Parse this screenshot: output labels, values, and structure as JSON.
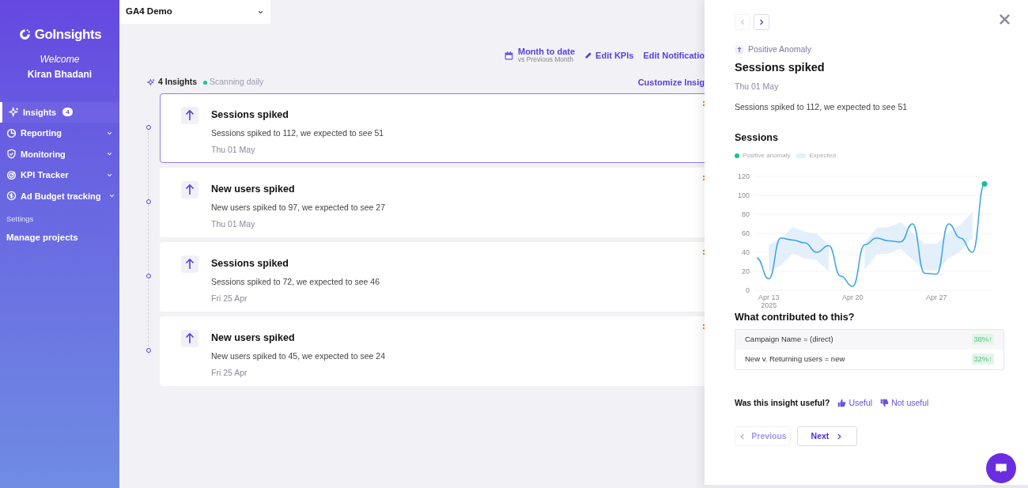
{
  "sidebar": {
    "logo": "GoInsights",
    "welcome": "Welcome",
    "user": "Kiran Bhadani",
    "items": [
      {
        "label": "Insights",
        "badge": "4",
        "selected": true,
        "expandable": false
      },
      {
        "label": "Reporting",
        "selected": false,
        "expandable": true
      },
      {
        "label": "Monitoring",
        "selected": false,
        "expandable": true
      },
      {
        "label": "KPI Tracker",
        "selected": false,
        "expandable": true
      },
      {
        "label": "Ad Budget tracking",
        "selected": false,
        "expandable": true
      }
    ],
    "section": "Settings",
    "links": [
      "Manage projects"
    ]
  },
  "project_select": {
    "value": "GA4 Demo"
  },
  "toolbar": {
    "period": "Month to date",
    "comparison": "vs Previous Month",
    "actions": [
      "Edit KPIs",
      "Edit Notificatio"
    ],
    "customize": "Customize Insig"
  },
  "summary": {
    "count": "4 Insights",
    "status": "Scanning daily"
  },
  "insights": [
    {
      "title": "Sessions spiked",
      "detail": "Sessions spiked to 112, we expected to see 51",
      "date": "Thu 01 May",
      "selected": true
    },
    {
      "title": "New users spiked",
      "detail": "New users spiked to 97, we expected to see 27",
      "date": "Thu 01 May",
      "selected": false
    },
    {
      "title": "Sessions spiked",
      "detail": "Sessions spiked to 72, we expected to see 46",
      "date": "Fri 25 Apr",
      "selected": false
    },
    {
      "title": "New users spiked",
      "detail": "New users spiked to 45, we expected to see 24",
      "date": "Fri 25 Apr",
      "selected": false
    }
  ],
  "panel": {
    "prev_disabled": true,
    "next_disabled": false,
    "type": "Positive Anomaly",
    "title": "Sessions spiked",
    "date": "Thu 01 May",
    "detail": "Sessions spiked to 112, we expected to see 51",
    "legend": [
      {
        "label": "Positive anomaly",
        "color": "#14c29a"
      },
      {
        "label": "Expected",
        "color": "#e3f0fb"
      }
    ],
    "chart_data": {
      "type": "line",
      "title": "Sessions",
      "categories": [
        null,
        "Apr 13 2025",
        null,
        null,
        null,
        null,
        null,
        null,
        "Apr 20",
        null,
        null,
        null,
        null,
        null,
        null,
        "Apr 27",
        null,
        null,
        null,
        null
      ],
      "series": [
        {
          "color": "#3fa3e6",
          "values": [
            34,
            12,
            55,
            53,
            50,
            40,
            47,
            15,
            4,
            48,
            55,
            52,
            51,
            70,
            18,
            17,
            70,
            55,
            40,
            112
          ]
        }
      ],
      "grid": true,
      "ylim": [
        0,
        120
      ],
      "yticks": [
        0,
        20,
        40,
        60,
        80,
        100,
        120
      ]
    },
    "contrib_title": "What contributed to this?",
    "contributors": [
      {
        "label": "Campaign Name = (direct)",
        "value": "38%↑"
      },
      {
        "label": "New v. Returning users = new",
        "value": "32%↑"
      }
    ],
    "feedback_q": "Was this insight useful?",
    "feedback": [
      "Useful",
      "Not useful"
    ],
    "previous": "Previous",
    "next": "Next"
  }
}
